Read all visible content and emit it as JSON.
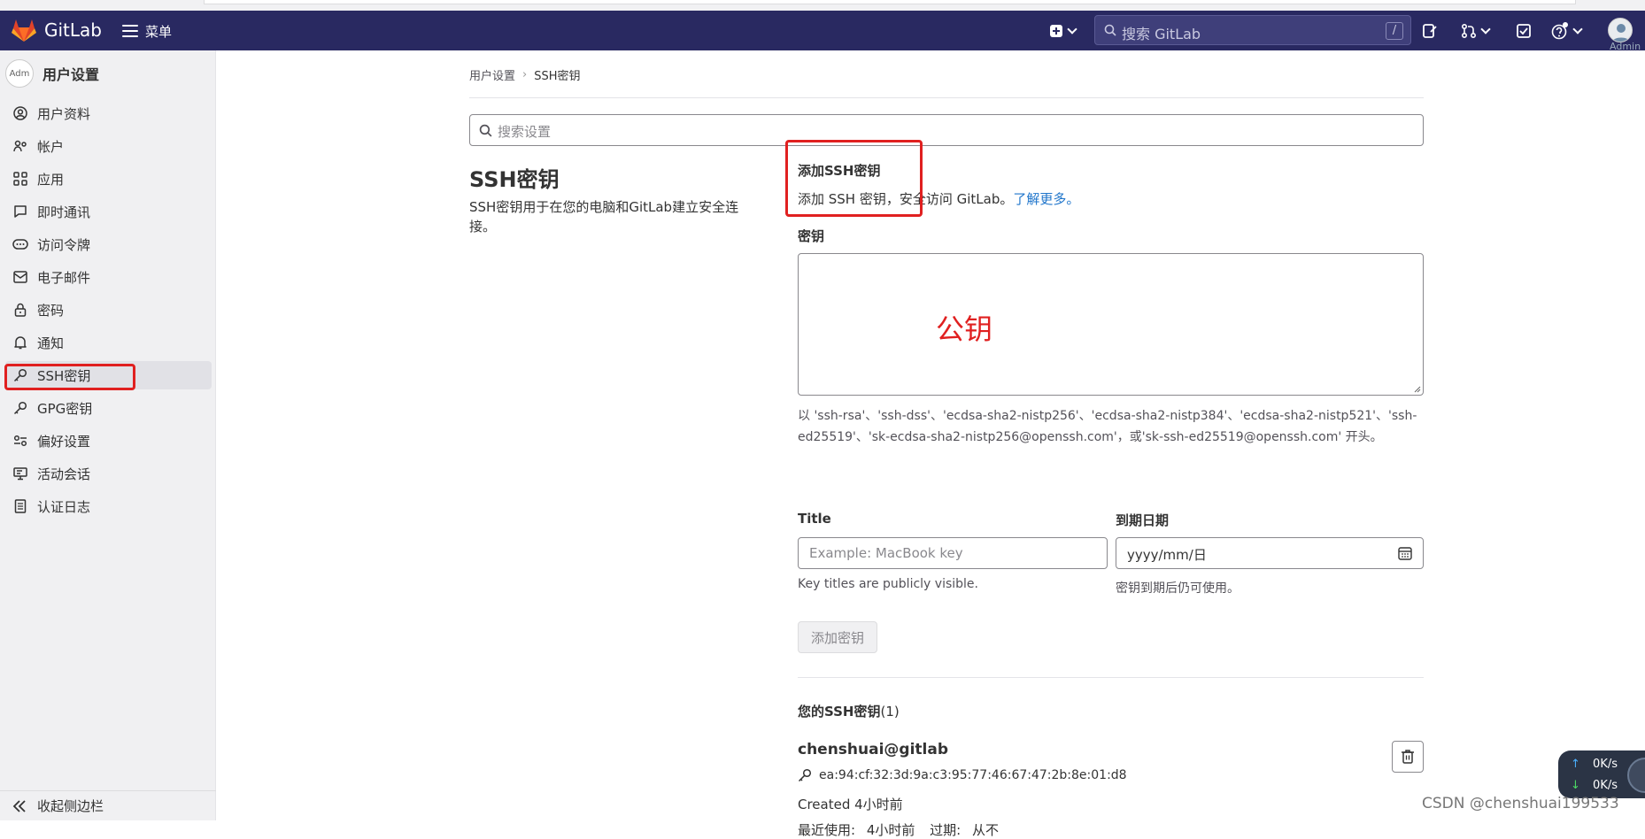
{
  "navbar": {
    "brand": "GitLab",
    "menu_label": "菜单",
    "search_placeholder": "搜索 GitLab",
    "search_shortcut": "/",
    "user_label": "Admin",
    "colors": {
      "bar": "#292961",
      "logo": "#e24329"
    }
  },
  "sidebar": {
    "avatar_alt": "Adm",
    "title": "用户设置",
    "items": [
      {
        "label": "用户资料",
        "icon": "profile-icon"
      },
      {
        "label": "帐户",
        "icon": "account-icon"
      },
      {
        "label": "应用",
        "icon": "applications-icon"
      },
      {
        "label": "即时通讯",
        "icon": "chat-icon"
      },
      {
        "label": "访问令牌",
        "icon": "token-icon"
      },
      {
        "label": "电子邮件",
        "icon": "mail-icon"
      },
      {
        "label": "密码",
        "icon": "lock-icon"
      },
      {
        "label": "通知",
        "icon": "bell-icon"
      },
      {
        "label": "SSH密钥",
        "icon": "key-icon",
        "active": true
      },
      {
        "label": "GPG密钥",
        "icon": "key-icon"
      },
      {
        "label": "偏好设置",
        "icon": "preferences-icon"
      },
      {
        "label": "活动会话",
        "icon": "monitor-icon"
      },
      {
        "label": "认证日志",
        "icon": "log-icon"
      }
    ],
    "collapse_label": "收起侧边栏"
  },
  "breadcrumb": {
    "parent": "用户设置",
    "current": "SSH密钥"
  },
  "settings_search": {
    "placeholder": "搜索设置"
  },
  "section": {
    "title": "SSH密钥",
    "description": "SSH密钥用于在您的电脑和GitLab建立安全连接。"
  },
  "form": {
    "heading": "添加SSH密钥",
    "subtitle": "添加 SSH 密钥，安全访问 GitLab。",
    "learn_more": "了解更多。",
    "key_label": "密钥",
    "key_annotation": "公钥",
    "key_hint": "以 'ssh-rsa'、'ssh-dss'、'ecdsa-sha2-nistp256'、'ecdsa-sha2-nistp384'、'ecdsa-sha2-nistp521'、'ssh-ed25519'、'sk-ecdsa-sha2-nistp256@openssh.com'，或'sk-ssh-ed25519@openssh.com' 开头。",
    "title_label": "Title",
    "title_placeholder": "Example: MacBook key",
    "title_hint": "Key titles are publicly visible.",
    "expires_label": "到期日期",
    "expires_value": "yyyy/mm/日",
    "expires_hint": "密钥到期后仍可使用。",
    "submit_label": "添加密钥"
  },
  "keys": {
    "heading": "您的SSH密钥",
    "count": "(1)",
    "items": [
      {
        "name": "chenshuai@gitlab",
        "fingerprint": "ea:94:cf:32:3d:9a:c3:95:77:46:67:47:2b:8e:01:d8",
        "created": "Created 4小时前",
        "last_used_label": "最近使用:",
        "last_used": "4小时前",
        "expires_label": "过期:",
        "expires": "从不"
      }
    ]
  },
  "net_widget": {
    "up": "0K/s",
    "down": "0K/s"
  },
  "watermark": "CSDN @chenshuai199533",
  "annotation_color": "#e02020"
}
